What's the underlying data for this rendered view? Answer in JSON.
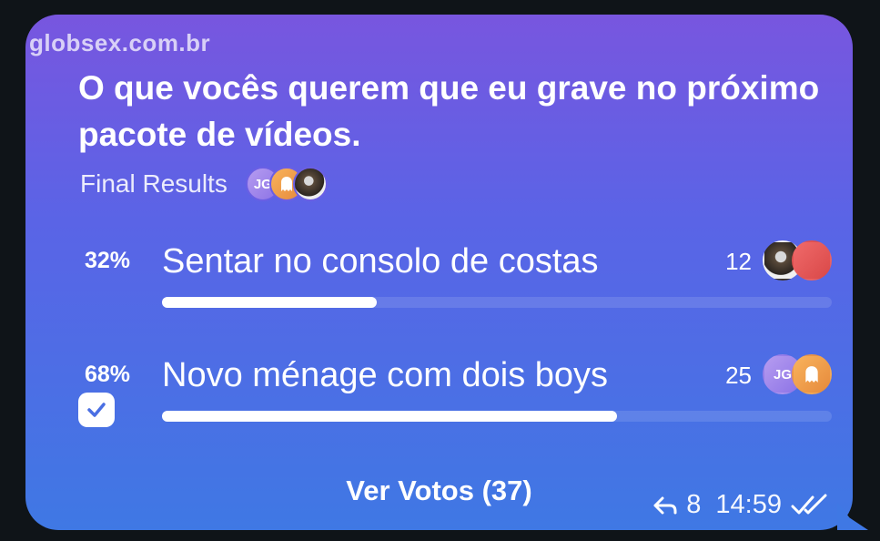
{
  "watermark": "globsex.com.br",
  "poll": {
    "question": "O que vocês querem que eu grave no próximo pacote de vídeos.",
    "status": "Final Results",
    "voter_avatars": [
      {
        "icon": "avatar-initials",
        "label": "JG"
      },
      {
        "icon": "ghost-icon",
        "label": ""
      },
      {
        "icon": "photo-avatar",
        "label": ""
      }
    ],
    "options": [
      {
        "percent_text": "32%",
        "percent": 32,
        "text": "Sentar no consolo de costas",
        "votes": "12",
        "selected": false,
        "avatars": [
          {
            "icon": "photo-avatar",
            "label": ""
          },
          {
            "icon": "red-avatar",
            "label": ""
          }
        ]
      },
      {
        "percent_text": "68%",
        "percent": 68,
        "text": "Novo ménage com dois boys",
        "votes": "25",
        "selected": true,
        "avatars": [
          {
            "icon": "avatar-initials",
            "label": "JG"
          },
          {
            "icon": "ghost-icon",
            "label": ""
          }
        ]
      }
    ],
    "view_votes_label": "Ver Votos (37)"
  },
  "message_meta": {
    "reply_icon": "reply-arrow-icon",
    "forwards": "8",
    "time": "14:59",
    "status_icon": "double-check-icon"
  },
  "colors": {
    "gradient_top": "#7856df",
    "gradient_bottom": "#3f78e4",
    "background": "#0f1418"
  }
}
